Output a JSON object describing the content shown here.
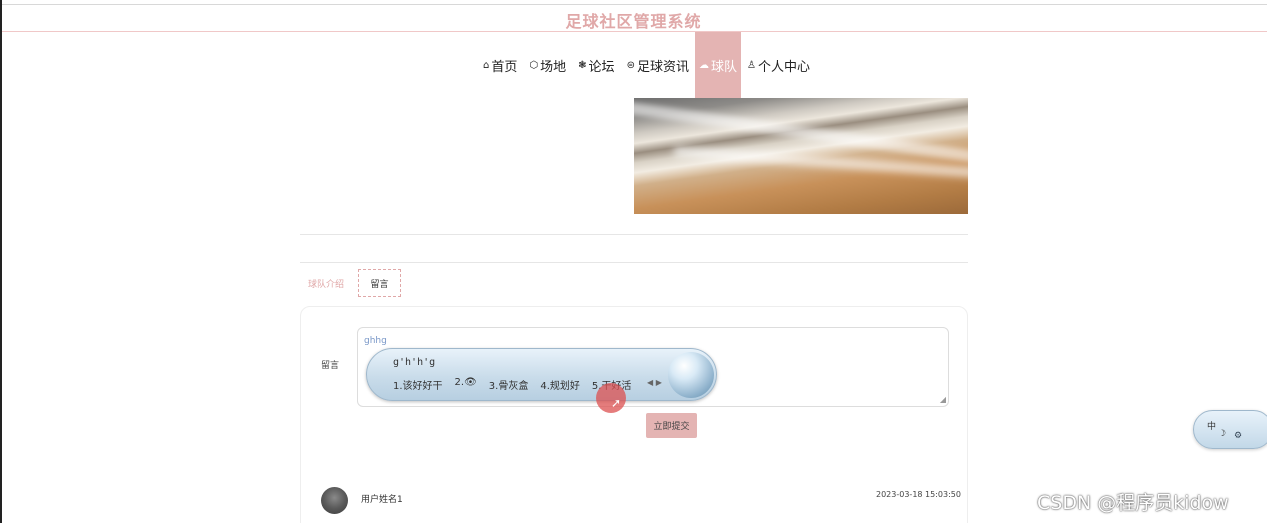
{
  "header": {
    "title": "足球社区管理系统"
  },
  "nav": {
    "items": [
      {
        "icon": "⌂",
        "label": "首页"
      },
      {
        "icon": "⬡",
        "label": "场地"
      },
      {
        "icon": "❃",
        "label": "论坛"
      },
      {
        "icon": "⊜",
        "label": "足球资讯"
      },
      {
        "icon": "☁",
        "label": "球队"
      },
      {
        "icon": "♙",
        "label": "个人中心"
      }
    ],
    "active": "球队"
  },
  "tabs": {
    "intro": "球队介绍",
    "message": "留言"
  },
  "form": {
    "label": "留言",
    "typed_text": "ghhg",
    "submit_label": "立即提交"
  },
  "ime": {
    "pinyin": "g'h'h'g",
    "candidates": [
      "1.该好好干",
      "2.👁",
      "3.骨灰盒",
      "4.规划好",
      "5.干好活"
    ],
    "mode": "中"
  },
  "comment": {
    "user": "用户姓名1",
    "time": "2023-03-18 15:03:50"
  },
  "watermark": "CSDN @程序员kidow",
  "colors": {
    "accent": "#e4b4b3",
    "title": "#e0a8a8"
  }
}
